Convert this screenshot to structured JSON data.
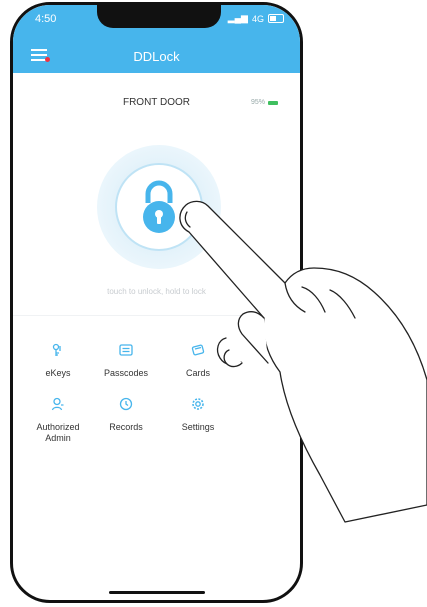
{
  "status_bar": {
    "time": "4:50",
    "network": "4G"
  },
  "app": {
    "title": "DDLock"
  },
  "lock": {
    "name": "FRONT DOOR",
    "battery": "95%"
  },
  "hint": "touch to unlock, hold to lock",
  "menu": [
    {
      "id": "ekeys",
      "label": "eKeys",
      "icon": "ekeys-icon"
    },
    {
      "id": "passcodes",
      "label": "Passcodes",
      "icon": "passcodes-icon"
    },
    {
      "id": "cards",
      "label": "Cards",
      "icon": "cards-icon"
    },
    {
      "id": "authorized-admin",
      "label": "Authorized Admin",
      "icon": "admin-icon"
    },
    {
      "id": "records",
      "label": "Records",
      "icon": "records-icon"
    },
    {
      "id": "settings",
      "label": "Settings",
      "icon": "settings-icon"
    }
  ],
  "colors": {
    "accent": "#47b5ec",
    "battery": "#3fbf5f"
  }
}
